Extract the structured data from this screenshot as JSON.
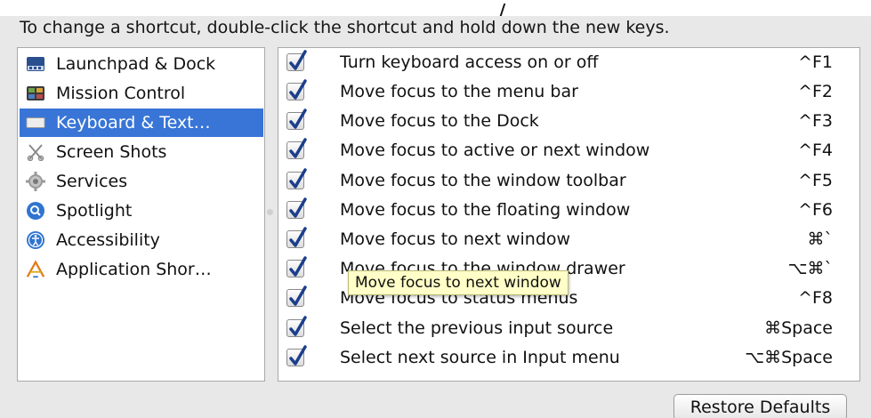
{
  "instruction": "To change a shortcut, double-click the shortcut and hold down the new keys.",
  "categories": [
    {
      "label": "Launchpad & Dock",
      "icon": "launchpad-dock-icon",
      "selected": false
    },
    {
      "label": "Mission Control",
      "icon": "mission-control-icon",
      "selected": false
    },
    {
      "label": "Keyboard & Text…",
      "icon": "keyboard-icon",
      "selected": true
    },
    {
      "label": "Screen Shots",
      "icon": "screenshot-icon",
      "selected": false
    },
    {
      "label": "Services",
      "icon": "gear-icon",
      "selected": false
    },
    {
      "label": "Spotlight",
      "icon": "spotlight-icon",
      "selected": false
    },
    {
      "label": "Accessibility",
      "icon": "accessibility-icon",
      "selected": false
    },
    {
      "label": "Application Shor…",
      "icon": "app-shortcuts-icon",
      "selected": false
    }
  ],
  "shortcuts": [
    {
      "action": "Turn keyboard access on or off",
      "keys": "^F1",
      "checked": true
    },
    {
      "action": "Move focus to the menu bar",
      "keys": "^F2",
      "checked": true
    },
    {
      "action": "Move focus to the Dock",
      "keys": "^F3",
      "checked": true
    },
    {
      "action": "Move focus to active or next window",
      "keys": "^F4",
      "checked": true
    },
    {
      "action": "Move focus to the window toolbar",
      "keys": "^F5",
      "checked": true
    },
    {
      "action": "Move focus to the floating window",
      "keys": "^F6",
      "checked": true
    },
    {
      "action": "Move focus to next window",
      "keys": "⌘`",
      "checked": true
    },
    {
      "action": "Move focus to the window drawer",
      "keys": "⌥⌘`",
      "checked": true
    },
    {
      "action": "Move focus to status menus",
      "keys": "^F8",
      "checked": true
    },
    {
      "action": "Select the previous input source",
      "keys": "⌘Space",
      "checked": true
    },
    {
      "action": "Select next source in Input menu",
      "keys": "⌥⌘Space",
      "checked": true
    }
  ],
  "tooltip": "Move focus to next window",
  "restore_button": "Restore Defaults",
  "colors": {
    "selection": "#3875d7",
    "checkmark": "#1c3f8c",
    "tooltip_bg": "#ffffc7"
  }
}
